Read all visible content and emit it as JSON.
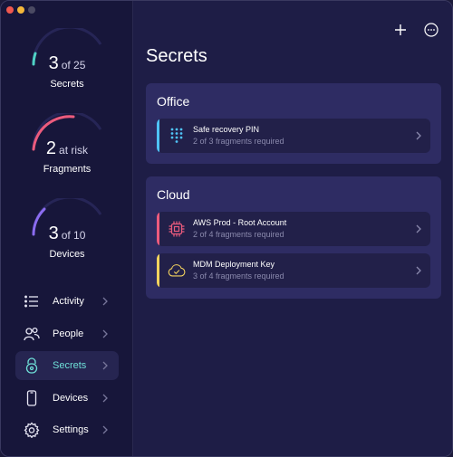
{
  "sidebar": {
    "stats": [
      {
        "value": "3",
        "suffix": "of 25",
        "label": "Secrets",
        "color": "#4fd1c5",
        "fraction": 0.12
      },
      {
        "value": "2",
        "suffix": "at risk",
        "label": "Fragments",
        "color": "#ec5b7d",
        "fraction": 0.4
      },
      {
        "value": "3",
        "suffix": "of 10",
        "label": "Devices",
        "color": "#8b6cf0",
        "fraction": 0.3
      }
    ],
    "nav": [
      {
        "label": "Activity",
        "icon": "list-icon"
      },
      {
        "label": "People",
        "icon": "people-icon"
      },
      {
        "label": "Secrets",
        "icon": "lock-icon",
        "active": true
      },
      {
        "label": "Devices",
        "icon": "phone-icon"
      },
      {
        "label": "Settings",
        "icon": "gear-icon"
      }
    ]
  },
  "main": {
    "title": "Secrets",
    "toolbar": {
      "add_icon": "plus-icon",
      "more_icon": "ellipsis-circle-icon"
    },
    "groups": [
      {
        "title": "Office",
        "items": [
          {
            "name": "Safe recovery PIN",
            "sub": "2 of 3 fragments required",
            "accent": "#4fc3f7",
            "icon": "keypad-icon"
          }
        ]
      },
      {
        "title": "Cloud",
        "items": [
          {
            "name": "AWS Prod - Root Account",
            "sub": "2 of 4 fragments required",
            "accent": "#ec5b7d",
            "icon": "chip-icon"
          },
          {
            "name": "MDM Deployment Key",
            "sub": "3 of 4 fragments required",
            "accent": "#f4d35e",
            "icon": "cloud-check-icon"
          }
        ]
      }
    ]
  }
}
